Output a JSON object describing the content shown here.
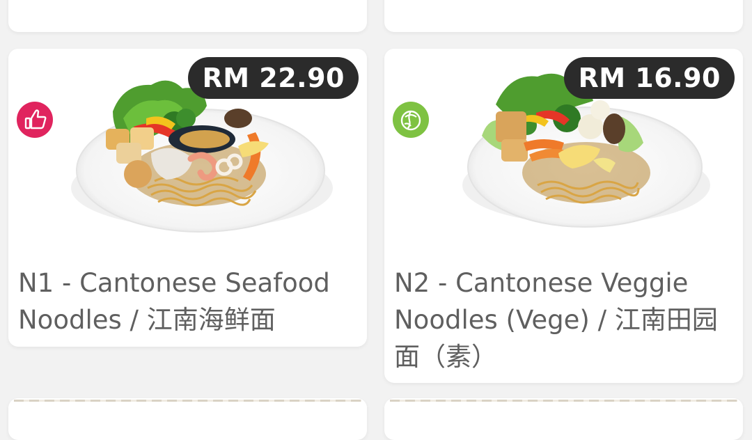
{
  "menu": {
    "items": [
      {
        "code_name": "N1 - Cantonese Seafood Noodles / 江南海鲜面",
        "price": "RM 22.90",
        "tag_icon": "thumbs-up-icon",
        "tag_color": "#e0245e"
      },
      {
        "code_name": "N2 - Cantonese Veggie Noodles (Vege) / 江南田园面（素）",
        "price": "RM 16.90",
        "tag_icon": "vegetable-icon",
        "tag_color": "#7ec242"
      }
    ]
  },
  "colors": {
    "page_bg": "#f2f2f2",
    "card_bg": "#ffffff",
    "badge_bg": "#2b2b2b",
    "name_text": "#5f5f5f"
  }
}
